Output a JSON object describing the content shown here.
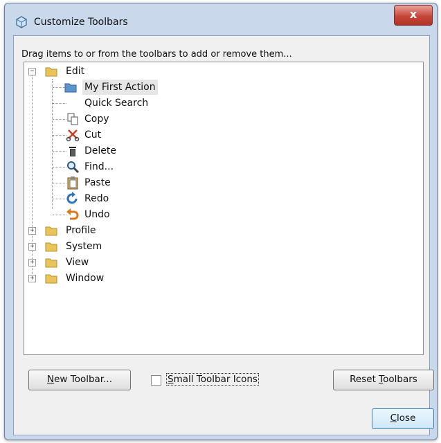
{
  "window": {
    "title": "Customize Toolbars",
    "close_glyph": "x"
  },
  "instruction": "Drag items to or from the toolbars to add or remove them...",
  "tree": {
    "edit": {
      "label": "Edit",
      "expander": "−",
      "children": [
        {
          "label": "My First Action",
          "icon": "folder-blue-icon",
          "selected": true
        },
        {
          "label": "Quick Search",
          "icon": "none"
        },
        {
          "label": "Copy",
          "icon": "copy-icon"
        },
        {
          "label": "Cut",
          "icon": "cut-icon"
        },
        {
          "label": "Delete",
          "icon": "trash-icon"
        },
        {
          "label": "Find...",
          "icon": "magnifier-icon"
        },
        {
          "label": "Paste",
          "icon": "paste-icon"
        },
        {
          "label": "Redo",
          "icon": "redo-icon"
        },
        {
          "label": "Undo",
          "icon": "undo-icon"
        }
      ]
    },
    "folders": [
      {
        "label": "Profile",
        "expander": "+"
      },
      {
        "label": "System",
        "expander": "+"
      },
      {
        "label": "View",
        "expander": "+"
      },
      {
        "label": "Window",
        "expander": "+"
      }
    ]
  },
  "buttons": {
    "new_toolbar": {
      "prefix": "",
      "mnemonic": "N",
      "rest": "ew Toolbar..."
    },
    "reset_toolbars": {
      "prefix": "Reset ",
      "mnemonic": "T",
      "rest": "oolbars"
    },
    "close": {
      "prefix": "",
      "mnemonic": "C",
      "rest": "lose"
    }
  },
  "small_icons": {
    "prefix": "",
    "mnemonic": "S",
    "rest": "mall Toolbar Icons",
    "checked": false
  },
  "colors": {
    "accent_close": "#c7463a",
    "folder": "#e8c45a",
    "selection": "#e6e6e6"
  }
}
